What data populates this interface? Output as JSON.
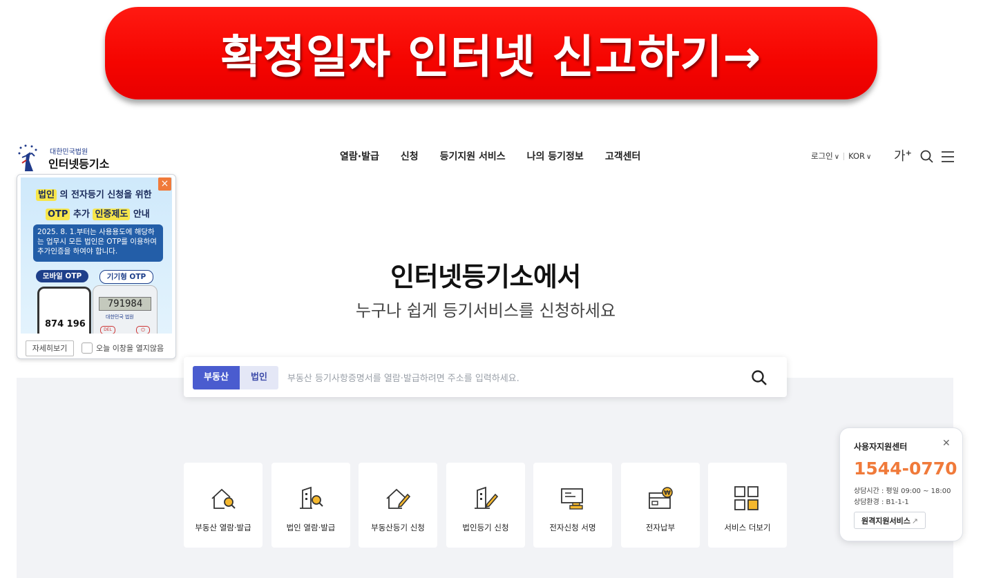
{
  "banner": {
    "text": "확정일자 인터넷 신고하기→"
  },
  "logo": {
    "small": "대한민국법원",
    "name": "인터넷등기소"
  },
  "nav": [
    "열람·발급",
    "신청",
    "등기지원 서비스",
    "나의 등기정보",
    "고객센터"
  ],
  "util": {
    "login": "로그인",
    "lang": "KOR",
    "font_size": "가",
    "font_size_sup": "+"
  },
  "hero": {
    "title": "인터넷등기소에서",
    "subtitle": "누구나 쉽게 등기서비스를 신청하세요"
  },
  "search": {
    "tabs": [
      "부동산",
      "법인"
    ],
    "active_tab": "부동산",
    "placeholder": "부동산 등기사항증명서를 열람·발급하려면 주소를 입력하세요."
  },
  "services": [
    {
      "label": "부동산 열람·발급",
      "icon": "house-search-icon"
    },
    {
      "label": "법인 열람·발급",
      "icon": "building-search-icon"
    },
    {
      "label": "부동산등기 신청",
      "icon": "house-edit-icon"
    },
    {
      "label": "법인등기 신청",
      "icon": "building-edit-icon"
    },
    {
      "label": "전자신청 서명",
      "icon": "e-sign-icon"
    },
    {
      "label": "전자납부",
      "icon": "e-payment-icon"
    },
    {
      "label": "서비스 더보기",
      "icon": "grid-more-icon"
    }
  ],
  "popup": {
    "line1_hl": "법인",
    "line1_rest": "의 전자등기 신청을 위한",
    "line2_a": "OTP",
    "line2_b": "추가",
    "line2_c": "인증제도",
    "line2_d": "안내",
    "notice": "2025. 8. 1.부터는 사용용도에 해당하는 업무시 모든 법인은 OTP를 이용하여 추가인증을 하여야 합니다.",
    "mobile_otp": "모바일 OTP",
    "device_otp": "기기형 OTP",
    "mobile_code": "874 196",
    "device_code": "791984",
    "device_brand": "대한민국 법원",
    "del_key": "DEL",
    "more_button": "자세히보기",
    "dont_show": "오늘 이창을 열지않음"
  },
  "support": {
    "title": "사용자지원센터",
    "phone": "1544-0770",
    "hours": "상담시간 : 평일 09:00 ~ 18:00",
    "env": "상담환경 : B1-1-1",
    "remote": "원격지원서비스"
  },
  "colors": {
    "banner": "#f50400",
    "primary": "#4a5ccf",
    "accent": "#f07a3a"
  }
}
